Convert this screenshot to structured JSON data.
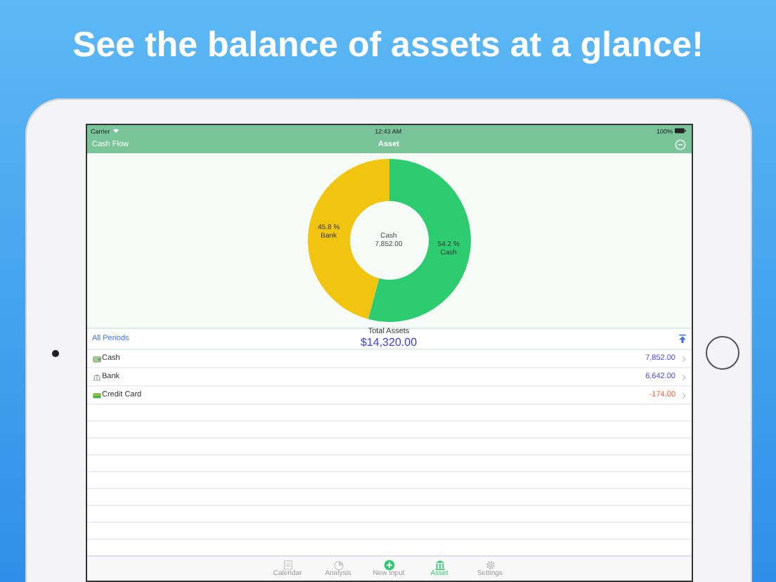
{
  "headline": "See the balance of assets at a glance!",
  "status_bar": {
    "carrier": "Carrier",
    "time": "12:43 AM",
    "battery": "100%"
  },
  "nav_bar": {
    "back": "Cash Flow",
    "title": "Asset"
  },
  "chart": {
    "center_label": "Cash",
    "center_value": "7,852.00",
    "chart_data": {
      "type": "donut",
      "categories": [
        "Cash",
        "Bank"
      ],
      "values": [
        54.2,
        45.8
      ],
      "colors": [
        "#2ecc71",
        "#f1c40f"
      ],
      "value_labels": [
        "54.2 %",
        "45.8 %"
      ]
    }
  },
  "summary": {
    "period": "All Periods",
    "total_label": "Total Assets",
    "total": "$14,320.00"
  },
  "accounts": [
    {
      "name": "Cash",
      "kind": "cash",
      "amount": "7,852.00",
      "negative": false
    },
    {
      "name": "Bank",
      "kind": "bank",
      "amount": "6,642.00",
      "negative": false
    },
    {
      "name": "Credit Card",
      "kind": "card",
      "amount": "-174.00",
      "negative": true
    }
  ],
  "tab_bar": [
    {
      "label": "Calendar",
      "kind": "calendar",
      "selected": false
    },
    {
      "label": "Analysis",
      "kind": "analysis",
      "selected": false
    },
    {
      "label": "New Input",
      "kind": "add",
      "selected": false
    },
    {
      "label": "Asset",
      "kind": "asset",
      "selected": true
    },
    {
      "label": "Settings",
      "kind": "settings",
      "selected": false
    }
  ]
}
